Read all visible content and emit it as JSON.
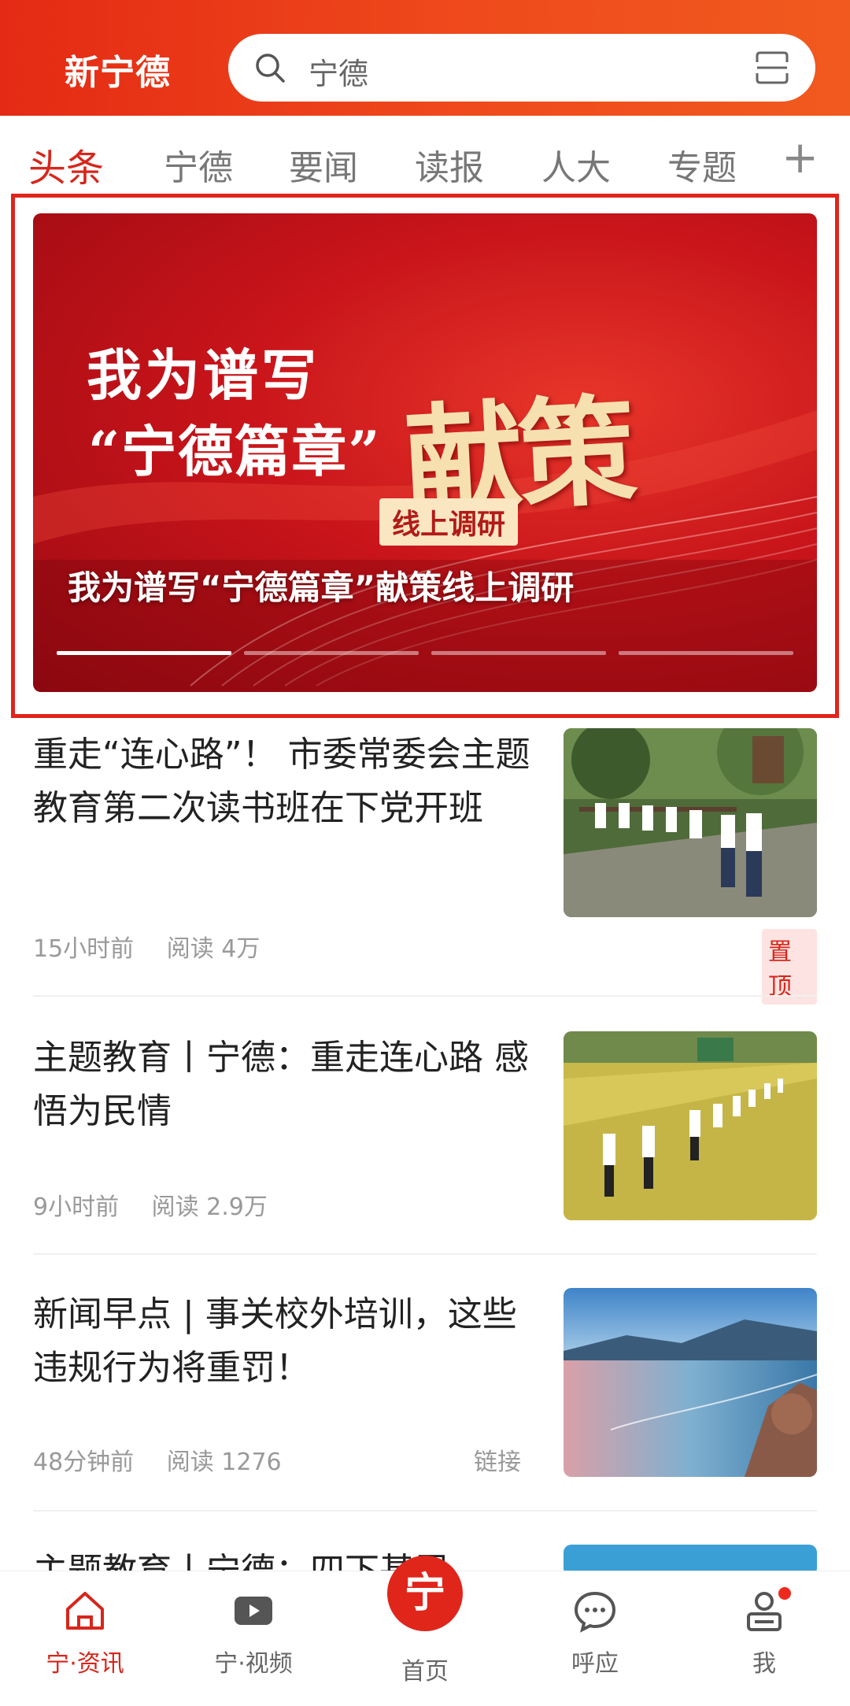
{
  "header": {
    "logo": "新宁德",
    "search_text": "宁德"
  },
  "tabs": [
    {
      "label": "头条",
      "active": true
    },
    {
      "label": "宁德"
    },
    {
      "label": "要闻"
    },
    {
      "label": "读报"
    },
    {
      "label": "人大"
    },
    {
      "label": "专题"
    }
  ],
  "tab_add": "+",
  "banner": {
    "line1": "我为谱写",
    "line2": "“宁德篇章”",
    "big": "献策",
    "tag": "线上调研",
    "caption": "我为谱写“宁德篇章”献策线上调研",
    "slides": 4,
    "active_slide": 1
  },
  "news": [
    {
      "title": "重走“连心路”！ 市委常委会主题教育第二次读书班在下党开班",
      "time": "15小时前",
      "reads": "阅读 4万",
      "badge": "置顶"
    },
    {
      "title": "主题教育丨宁德：重走连心路 感悟为民情",
      "time": "9小时前",
      "reads": "阅读 2.9万"
    },
    {
      "title": "新闻早点 | 事关校外培训，这些违规行为将重罚！",
      "time": "48分钟前",
      "reads": "阅读 1276",
      "link": "链接"
    },
    {
      "title": "主题教育丨宁德：四下基层"
    }
  ],
  "bottom_nav": [
    {
      "label": "宁·资讯",
      "icon": "house-icon",
      "active": true
    },
    {
      "label": "宁·视频",
      "icon": "video-play-icon"
    },
    {
      "label": "首页",
      "icon": "home-logo-icon",
      "glyph": "宁"
    },
    {
      "label": "呼应",
      "icon": "chat-bubble-icon"
    },
    {
      "label": "我",
      "icon": "user-profile-icon"
    }
  ],
  "colors": {
    "brand_red": "#d7261b",
    "header_gradient": [
      "#e42a14",
      "#f15a1e"
    ]
  }
}
